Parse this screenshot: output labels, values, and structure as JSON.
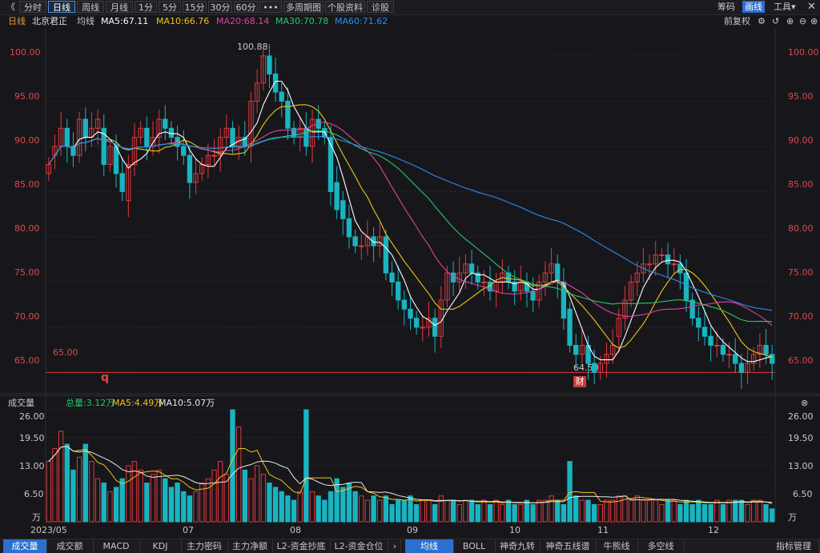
{
  "toolbar": {
    "back_icon": "《",
    "tabs": [
      "分时",
      "日线",
      "周线",
      "月线",
      "1分",
      "5分",
      "15分",
      "30分",
      "60分",
      "•••",
      "多周期图",
      "个股资料",
      "诊股"
    ],
    "active_tab": "日线",
    "right": [
      "筹码",
      "画线",
      "工具▾"
    ],
    "icons": [
      "close-icon",
      "plus-icon",
      "minus-icon",
      "settings-icon"
    ]
  },
  "header": {
    "period": "日线",
    "stock": "北京君正",
    "ma_label": "均线",
    "ma": [
      {
        "label": "MA5:67.11",
        "color": "#ffffff"
      },
      {
        "label": "MA10:66.76",
        "color": "#f0c419"
      },
      {
        "label": "MA20:68.14",
        "color": "#e040a0"
      },
      {
        "label": "MA30:70.78",
        "color": "#2cc46b"
      },
      {
        "label": "MA60:71.62",
        "color": "#2a8bf0"
      }
    ],
    "fuquan": "前复权"
  },
  "price_axis": {
    "ticks": [
      "100.00",
      "95.00",
      "90.00",
      "85.00",
      "80.00",
      "75.00",
      "70.00",
      "65.00"
    ]
  },
  "annotations": {
    "high": "100.88",
    "low": "64.50",
    "support_line": "65.00",
    "q_marker": "q",
    "cai_badge": "财"
  },
  "volume_header": {
    "title": "成交量",
    "total": "总量:3.12万",
    "ma5": "MA5:4.49万",
    "ma10": "MA10:5.07万"
  },
  "volume_axis": {
    "ticks": [
      "26.00",
      "19.50",
      "13.00",
      "6.50",
      "万"
    ]
  },
  "x_axis": {
    "labels": [
      "2023/05",
      "07",
      "08",
      "09",
      "10",
      "11",
      "12"
    ]
  },
  "bottom_tabs": {
    "left": [
      "成交量",
      "成交额",
      "MACD",
      "KDJ",
      "主力密码",
      "主力净额",
      "L2-资金抄底",
      "L2-资金仓位"
    ],
    "right": [
      "均线",
      "BOLL",
      "神奇九转",
      "神奇五线谱",
      "牛熊线",
      "多空线",
      "指标管理"
    ]
  },
  "chart_data": {
    "type": "candlestick",
    "ylim": [
      63,
      103
    ],
    "closes": [
      88,
      90,
      92,
      90,
      89,
      93,
      91,
      92,
      93,
      88,
      90,
      87,
      85,
      88,
      91,
      92,
      90,
      91,
      93,
      92,
      91,
      90,
      89,
      86,
      87,
      88,
      89,
      89,
      91,
      92,
      90,
      91,
      90,
      95,
      97,
      100,
      98,
      96,
      95,
      92,
      91,
      92,
      90,
      93,
      92,
      91,
      85,
      83,
      82,
      80,
      79,
      79,
      80,
      79,
      80,
      76,
      75,
      73,
      72,
      71,
      70,
      70,
      71,
      69,
      73,
      76,
      75,
      76,
      77,
      76,
      75,
      75,
      74,
      75,
      76,
      75,
      74,
      75,
      74,
      73,
      75,
      76,
      77,
      75,
      71,
      68,
      67,
      68,
      66,
      65,
      66,
      67,
      68,
      71,
      73,
      75,
      76,
      77,
      77,
      78,
      78,
      77,
      77,
      76,
      73,
      71,
      70,
      69,
      68,
      68,
      67,
      67,
      66,
      65,
      66,
      67,
      68,
      67,
      66
    ],
    "opens": [
      87,
      89,
      90,
      92,
      90,
      89,
      93,
      91,
      92,
      92,
      88,
      90,
      87,
      84,
      88,
      91,
      92,
      90,
      91,
      93,
      92,
      91,
      90,
      89,
      86,
      87,
      88,
      89,
      89,
      91,
      92,
      90,
      91,
      90,
      95,
      97,
      100,
      98,
      96,
      95,
      92,
      91,
      92,
      90,
      93,
      92,
      91,
      86,
      84,
      82,
      80,
      79,
      79,
      80,
      79,
      80,
      76,
      75,
      73,
      72,
      71,
      70,
      70,
      71,
      69,
      73,
      76,
      75,
      76,
      77,
      76,
      75,
      75,
      74,
      75,
      76,
      75,
      74,
      75,
      74,
      73,
      75,
      76,
      77,
      75,
      72,
      68,
      67,
      68,
      66,
      65,
      66,
      67,
      69,
      71,
      73,
      75,
      76,
      77,
      77,
      78,
      78,
      77,
      77,
      76,
      73,
      71,
      70,
      69,
      68,
      68,
      67,
      67,
      66,
      65,
      66,
      67,
      68,
      67
    ],
    "volumes": [
      14,
      17,
      21,
      18,
      12,
      15,
      18,
      14,
      10,
      9,
      7,
      8,
      10,
      13,
      14,
      12,
      9,
      11,
      12,
      10,
      8,
      9,
      7,
      6,
      7,
      9,
      10,
      12,
      14,
      11,
      26,
      22,
      12,
      10,
      13,
      11,
      9,
      8,
      7,
      6,
      5,
      7,
      26,
      7,
      6,
      5,
      7,
      10,
      8,
      9,
      7,
      6,
      5,
      6,
      5,
      6,
      4,
      5,
      5,
      6,
      4,
      5,
      5,
      4,
      6,
      5,
      5,
      4,
      5,
      5,
      4,
      5,
      4,
      5,
      4,
      5,
      4,
      4,
      5,
      4,
      5,
      5,
      6,
      5,
      4,
      14,
      6,
      5,
      5,
      4,
      4,
      5,
      5,
      6,
      6,
      5,
      6,
      5,
      5,
      5,
      4,
      5,
      5,
      4,
      5,
      4,
      5,
      4,
      4,
      5,
      4,
      5,
      5,
      5,
      4,
      5,
      5,
      4,
      3
    ],
    "vol_ylim": [
      0,
      26
    ]
  }
}
